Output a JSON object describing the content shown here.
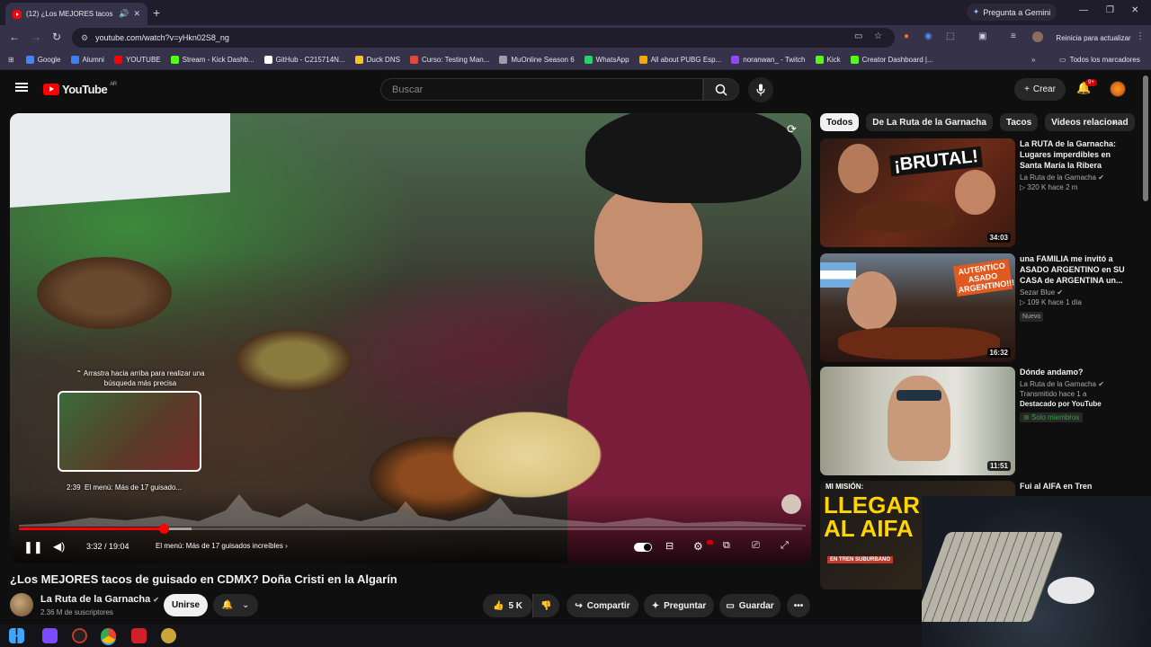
{
  "browser": {
    "tab_title": "(12) ¿Los MEJORES tacos de",
    "new_tab": "+",
    "gemini": "Pregunta a Gemini",
    "url": "youtube.com/watch?v=yHkn02S8_ng",
    "update": "Reinicia para actualizar",
    "bookmarks": [
      {
        "label": "Google",
        "color": "#4285f4"
      },
      {
        "label": "Alumni",
        "color": "#3b82f6"
      },
      {
        "label": "YOUTUBE",
        "color": "#ff0000"
      },
      {
        "label": "Stream - Kick Dashb...",
        "color": "#53fc18"
      },
      {
        "label": "GitHub - C215714N...",
        "color": "#ffffff"
      },
      {
        "label": "Duck DNS",
        "color": "#f7c325"
      },
      {
        "label": "Curso: Testing Man...",
        "color": "#e04a3a"
      },
      {
        "label": "MuOnline Season 6",
        "color": "#9aa0a6"
      },
      {
        "label": "WhatsApp",
        "color": "#25d366"
      },
      {
        "label": "All about PUBG Esp...",
        "color": "#f2a900"
      },
      {
        "label": "noranwan_ - Twitch",
        "color": "#9146ff"
      },
      {
        "label": "Kick",
        "color": "#53fc18"
      },
      {
        "label": "Creator Dashboard |...",
        "color": "#53fc18"
      }
    ],
    "all_bookmarks": "Todos los marcadores"
  },
  "header": {
    "logo_text": "YouTube",
    "region": "AR",
    "search_placeholder": "Buscar",
    "create": "Crear",
    "notifications": "9+"
  },
  "player": {
    "drag_hint": "Arrastra hacia arriba para realizar una búsqueda más precisa",
    "preview_time": "2:39",
    "preview_label": "El menú: Más de 17 guisado...",
    "time": "3:32 / 19:04",
    "chapter": "El menú: Más de 17 guisados increíbles",
    "progress_fraction": 0.185,
    "buffer_fraction": 0.22
  },
  "video": {
    "title": "¿Los MEJORES tacos de guisado en CDMX? Doña Cristi en la Algarín",
    "channel": "La Ruta de la Garnacha",
    "subscribers": "2.36 M de suscriptores",
    "join": "Unirse",
    "likes": "5 K",
    "share": "Compartir",
    "ask": "Preguntar",
    "save": "Guardar"
  },
  "sidebar": {
    "chips": [
      "Todos",
      "De La Ruta de la Garnacha",
      "Tacos",
      "Videos relacionad"
    ],
    "cards": [
      {
        "title": "La RUTA de la Garnacha: Lugares imperdibles en Santa María la Ribera",
        "channel": "La Ruta de la Garnacha",
        "meta": "320 K  hace 2 m",
        "duration": "34:03",
        "thumb_text": "¡BRUTAL!"
      },
      {
        "title": "una FAMILIA me invitó a ASADO ARGENTINO en SU CASA de ARGENTINA un...",
        "channel": "Sezar Blue",
        "meta": "109 K  hace 1 día",
        "badge": "Nuevo",
        "duration": "16:32",
        "thumb_text": "AUTENTICO ASADO ARGENTINO!!!"
      },
      {
        "title": "Dónde andamo?",
        "channel": "La Ruta de la Garnacha",
        "meta": "Transmitido hace 1 a",
        "featured": "Destacado por YouTube",
        "members": "Solo miembros",
        "duration": "11:51"
      },
      {
        "title": "Fui al AIFA en Tren",
        "thumb_text": "LLEGAR AL AIFA",
        "thumb_sub": "MI MISIÓN:",
        "thumb_foot": "EN TREN SUBURBANO"
      }
    ]
  }
}
